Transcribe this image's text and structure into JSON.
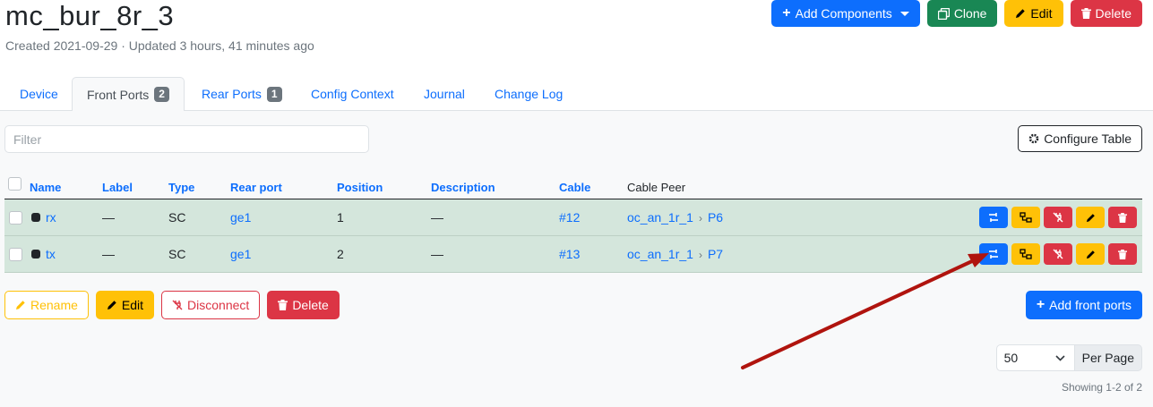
{
  "page": {
    "title": "mc_bur_8r_3",
    "subtitle": "Created 2021-09-29 · Updated 3 hours, 41 minutes ago"
  },
  "header_buttons": {
    "add_components": "Add Components",
    "clone": "Clone",
    "edit": "Edit",
    "delete": "Delete"
  },
  "tabs": [
    {
      "label": "Device"
    },
    {
      "label": "Front Ports",
      "badge": "2"
    },
    {
      "label": "Rear Ports",
      "badge": "1"
    },
    {
      "label": "Config Context"
    },
    {
      "label": "Journal"
    },
    {
      "label": "Change Log"
    }
  ],
  "filter": {
    "placeholder": "Filter"
  },
  "configure_table": "Configure Table",
  "columns": [
    "Name",
    "Label",
    "Type",
    "Rear port",
    "Position",
    "Description",
    "Cable",
    "Cable Peer"
  ],
  "rows": [
    {
      "name": "rx",
      "label": "—",
      "type": "SC",
      "rear_port": "ge1",
      "position": "1",
      "description": "—",
      "cable": "#12",
      "peer_device": "oc_an_1r_1",
      "peer_port": "P6"
    },
    {
      "name": "tx",
      "label": "—",
      "type": "SC",
      "rear_port": "ge1",
      "position": "2",
      "description": "—",
      "cable": "#13",
      "peer_device": "oc_an_1r_1",
      "peer_port": "P7"
    }
  ],
  "bulk_buttons": {
    "rename": "Rename",
    "edit": "Edit",
    "disconnect": "Disconnect",
    "delete": "Delete"
  },
  "add_front_ports": "Add front ports",
  "pagination": {
    "per_page_value": "50",
    "per_page_label": "Per Page",
    "showing": "Showing 1-2 of 2"
  },
  "colors": {
    "primary": "#0d6efd",
    "success": "#198754",
    "warning": "#ffc107",
    "danger": "#dc3545",
    "row_bg": "#d4e6dc",
    "annotation_arrow": "#b0140e"
  },
  "icons": [
    "plus-icon",
    "clone-icon",
    "pencil-icon",
    "trash-icon",
    "gear-icon",
    "trace-icon",
    "connect-icon",
    "disconnect-icon",
    "chevron-right-icon",
    "chevron-down-icon"
  ]
}
